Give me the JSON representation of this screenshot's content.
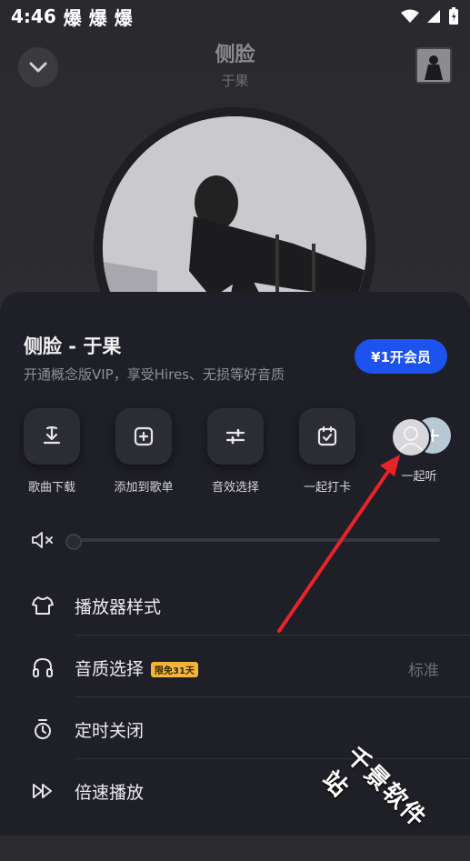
{
  "status_bar": {
    "time": "4:46",
    "notifications": [
      "爆",
      "爆",
      "爆"
    ]
  },
  "player": {
    "title": "侧脸",
    "artist": "于果"
  },
  "sheet": {
    "title": "侧脸 - 于果",
    "subtitle": "开通概念版VIP，享受Hires、无损等好音质",
    "vip_button": "¥1开会员",
    "actions": [
      {
        "label": "歌曲下载",
        "icon": "download-icon"
      },
      {
        "label": "添加到歌单",
        "icon": "add-to-playlist-icon"
      },
      {
        "label": "音效选择",
        "icon": "equalizer-icon"
      },
      {
        "label": "一起打卡",
        "icon": "check-in-icon"
      },
      {
        "label": "一起听",
        "icon": "listen-together-icon"
      }
    ],
    "volume": 0.0,
    "menu": [
      {
        "label": "播放器样式",
        "icon": "shirt-icon"
      },
      {
        "label": "音质选择",
        "icon": "headphones-icon",
        "badge": "限免31天",
        "value": "标准"
      },
      {
        "label": "定时关闭",
        "icon": "timer-icon"
      },
      {
        "label": "倍速播放",
        "icon": "speed-icon"
      }
    ]
  },
  "watermark": "千景软件站",
  "colors": {
    "vip": "#1c52ee",
    "badge": "#f3b63a",
    "arrow": "#e8232a"
  }
}
